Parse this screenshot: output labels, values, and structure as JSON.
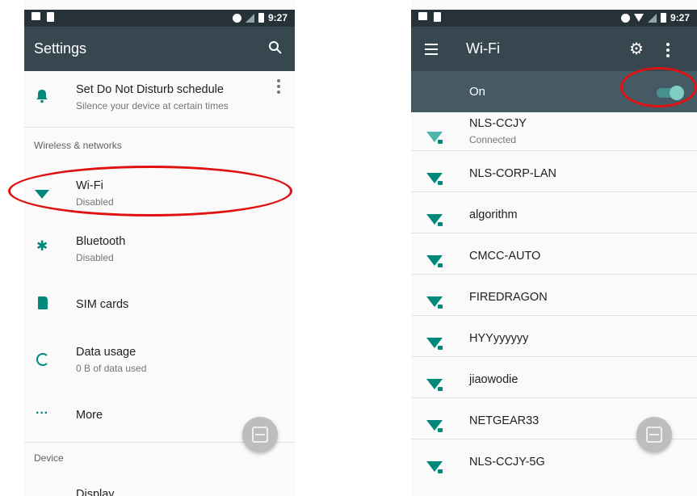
{
  "status_bar": {
    "time": "9:27"
  },
  "left": {
    "toolbar": {
      "title": "Settings"
    },
    "dnd": {
      "title": "Set Do Not Disturb schedule",
      "subtitle": "Silence your device at certain times"
    },
    "section_wireless": "Wireless & networks",
    "wifi": {
      "title": "Wi-Fi",
      "subtitle": "Disabled"
    },
    "bluetooth": {
      "title": "Bluetooth",
      "subtitle": "Disabled"
    },
    "sim": {
      "title": "SIM cards"
    },
    "data_usage": {
      "title": "Data usage",
      "subtitle": "0 B of data used"
    },
    "more": {
      "title": "More"
    },
    "section_device": "Device",
    "display": {
      "title": "Display"
    }
  },
  "right": {
    "toolbar": {
      "title": "Wi-Fi"
    },
    "switch": {
      "label": "On"
    },
    "networks": [
      {
        "ssid": "NLS-CCJY",
        "status": "Connected"
      },
      {
        "ssid": "NLS-CORP-LAN"
      },
      {
        "ssid": "algorithm"
      },
      {
        "ssid": "CMCC-AUTO"
      },
      {
        "ssid": "FIREDRAGON"
      },
      {
        "ssid": "HYYyyyyyy"
      },
      {
        "ssid": "jiaowodie"
      },
      {
        "ssid": "NETGEAR33"
      },
      {
        "ssid": "NLS-CCJY-5G"
      }
    ]
  },
  "colors": {
    "accent": "#00897b",
    "toolbar": "#37474f",
    "annotation": "#e01111"
  }
}
